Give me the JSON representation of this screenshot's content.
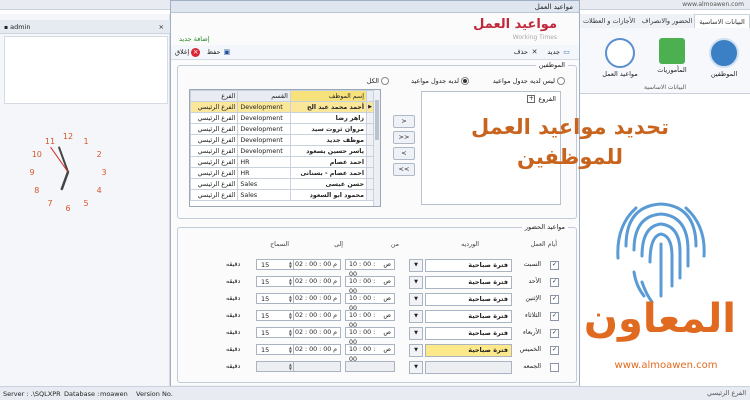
{
  "browser": {
    "url": "www.almoawen.com"
  },
  "app": {
    "ribbon_tabs": [
      "البيانات الاساسية",
      "الحضور والانصراف",
      "الأجازات و العطلات"
    ],
    "ribbon_buttons": [
      "الموظفين",
      "المأموريات",
      "مواعيد العمل"
    ],
    "ribbon_group": "البيانات الاساسية",
    "admin": "admin"
  },
  "clock": {
    "numbers": [
      "12",
      "1",
      "2",
      "3",
      "4",
      "5",
      "6",
      "7",
      "8",
      "9",
      "10",
      "11"
    ]
  },
  "dialog": {
    "title": "مواعيد العمل",
    "heading": "مواعيد العمل",
    "subtitle": "Working Times",
    "add_new": "إضافة جديد",
    "toolbar": {
      "new": "جديد",
      "delete": "حذف",
      "save": "حفظ",
      "close": "إغلاق"
    },
    "employees_legend": "الموظفين",
    "radios": [
      "ليس لديه جدول مواعيد",
      "لديه جدول مواعيد",
      "الكل"
    ],
    "selected_radio": 1,
    "tree_root": "الفروع",
    "move_buttons": [
      ">",
      ">>",
      "<",
      "<<"
    ],
    "grid": {
      "columns": [
        "إسم الموظف",
        "القسم",
        "الفرع"
      ],
      "rows": [
        [
          "أحمد محمد عبد الح",
          "Development",
          "الفرع الرئيسي"
        ],
        [
          "زاهر رضا",
          "Development",
          "الفرع الرئيسي"
        ],
        [
          "مروان ثروت سيد",
          "Development",
          "الفرع الرئيسي"
        ],
        [
          "موظف جديد",
          "Development",
          "الفرع الرئيسي"
        ],
        [
          "ياسر حسين يسعود",
          "Development",
          "الفرع الرئيسي"
        ],
        [
          "احمد عصام",
          "HR",
          "الفرع الرئيسي"
        ],
        [
          "احمد عصام - بسنانى",
          "HR",
          "الفرع الرئيسي"
        ],
        [
          "حسن عيسى",
          "Sales",
          "الفرع الرئيسي"
        ],
        [
          "محمود ابو السعود",
          "Sales",
          "الفرع الرئيسي"
        ]
      ]
    },
    "schedule": {
      "legend": "مواعيد الحضور",
      "headers": {
        "days": "أيام العمل",
        "shift": "الورديه",
        "from": "من",
        "to": "إلى",
        "grace": "السماح"
      },
      "am": "ص",
      "pm": "م",
      "minutes": "دقيقه",
      "rows": [
        {
          "day": "السبت",
          "checked": true,
          "shift": "فترة صباحية",
          "from": "10 : 00 : 00",
          "to": "02 : 00 : 00",
          "grace": "15",
          "highlight": false,
          "enabled": true
        },
        {
          "day": "الأحد",
          "checked": true,
          "shift": "فترة صباحية",
          "from": "10 : 00 : 00",
          "to": "02 : 00 : 00",
          "grace": "15",
          "highlight": false,
          "enabled": true
        },
        {
          "day": "الإثنين",
          "checked": true,
          "shift": "فترة صباحية",
          "from": "10 : 00 : 00",
          "to": "02 : 00 : 00",
          "grace": "15",
          "highlight": false,
          "enabled": true
        },
        {
          "day": "الثلاثاء",
          "checked": true,
          "shift": "فترة صباحية",
          "from": "10 : 00 : 00",
          "to": "02 : 00 : 00",
          "grace": "15",
          "highlight": false,
          "enabled": true
        },
        {
          "day": "الأربعاء",
          "checked": true,
          "shift": "فترة صباحية",
          "from": "10 : 00 : 00",
          "to": "02 : 00 : 00",
          "grace": "15",
          "highlight": false,
          "enabled": true
        },
        {
          "day": "الخميس",
          "checked": true,
          "shift": "فترة صباحية",
          "from": "10 : 00 : 00",
          "to": "02 : 00 : 00",
          "grace": "15",
          "highlight": true,
          "enabled": true
        },
        {
          "day": "الجمعه",
          "checked": false,
          "shift": "",
          "from": "",
          "to": "",
          "grace": "",
          "highlight": false,
          "enabled": false
        }
      ]
    }
  },
  "statusbar": {
    "server": "Server : .\\SQLXPR",
    "database": "Database :",
    "db_name": "moawen",
    "version": "Version No."
  },
  "promo": {
    "line1": "تحديد مواعيد العمل",
    "line2": "للموظفين",
    "brand": "المعاون",
    "url": "www.almoawen.com"
  },
  "footer_branch": "الفرع الرئيسي",
  "colors": {
    "accent_red": "#c0283b",
    "promo_orange": "#e06a20",
    "fingerprint": "#5b9bd5"
  }
}
